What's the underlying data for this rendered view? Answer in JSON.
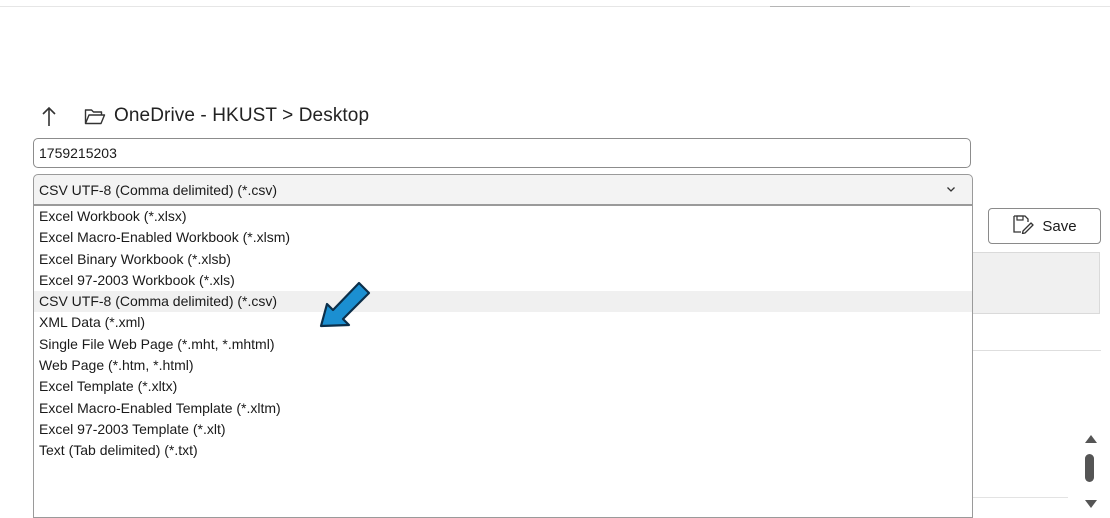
{
  "breadcrumb": {
    "path": "OneDrive - HKUST > Desktop",
    "up_icon": "arrow-up-icon",
    "folder_icon": "folder-open-icon"
  },
  "filename": {
    "value": "1759215203"
  },
  "file_type": {
    "selected": "CSV UTF-8 (Comma delimited) (*.csv)",
    "chevron_icon": "chevron-down-icon",
    "options": [
      "Excel Workbook (*.xlsx)",
      "Excel Macro-Enabled Workbook (*.xlsm)",
      "Excel Binary Workbook (*.xlsb)",
      "Excel 97-2003 Workbook (*.xls)",
      "CSV UTF-8 (Comma delimited) (*.csv)",
      "XML Data (*.xml)",
      "Single File Web Page (*.mht, *.mhtml)",
      "Web Page (*.htm, *.html)",
      "Excel Template (*.xltx)",
      "Excel Macro-Enabled Template (*.xltm)",
      "Excel 97-2003 Template (*.xlt)",
      "Text (Tab delimited) (*.txt)"
    ],
    "highlighted_index": 4
  },
  "save_button": {
    "label": "Save",
    "icon": "save-icon"
  },
  "annotation": {
    "icon": "pointer-arrow-icon",
    "color": "#1b8fd1"
  },
  "colors": {
    "accent": "#1b8fd1",
    "selected_row": "#f0f0f0"
  }
}
